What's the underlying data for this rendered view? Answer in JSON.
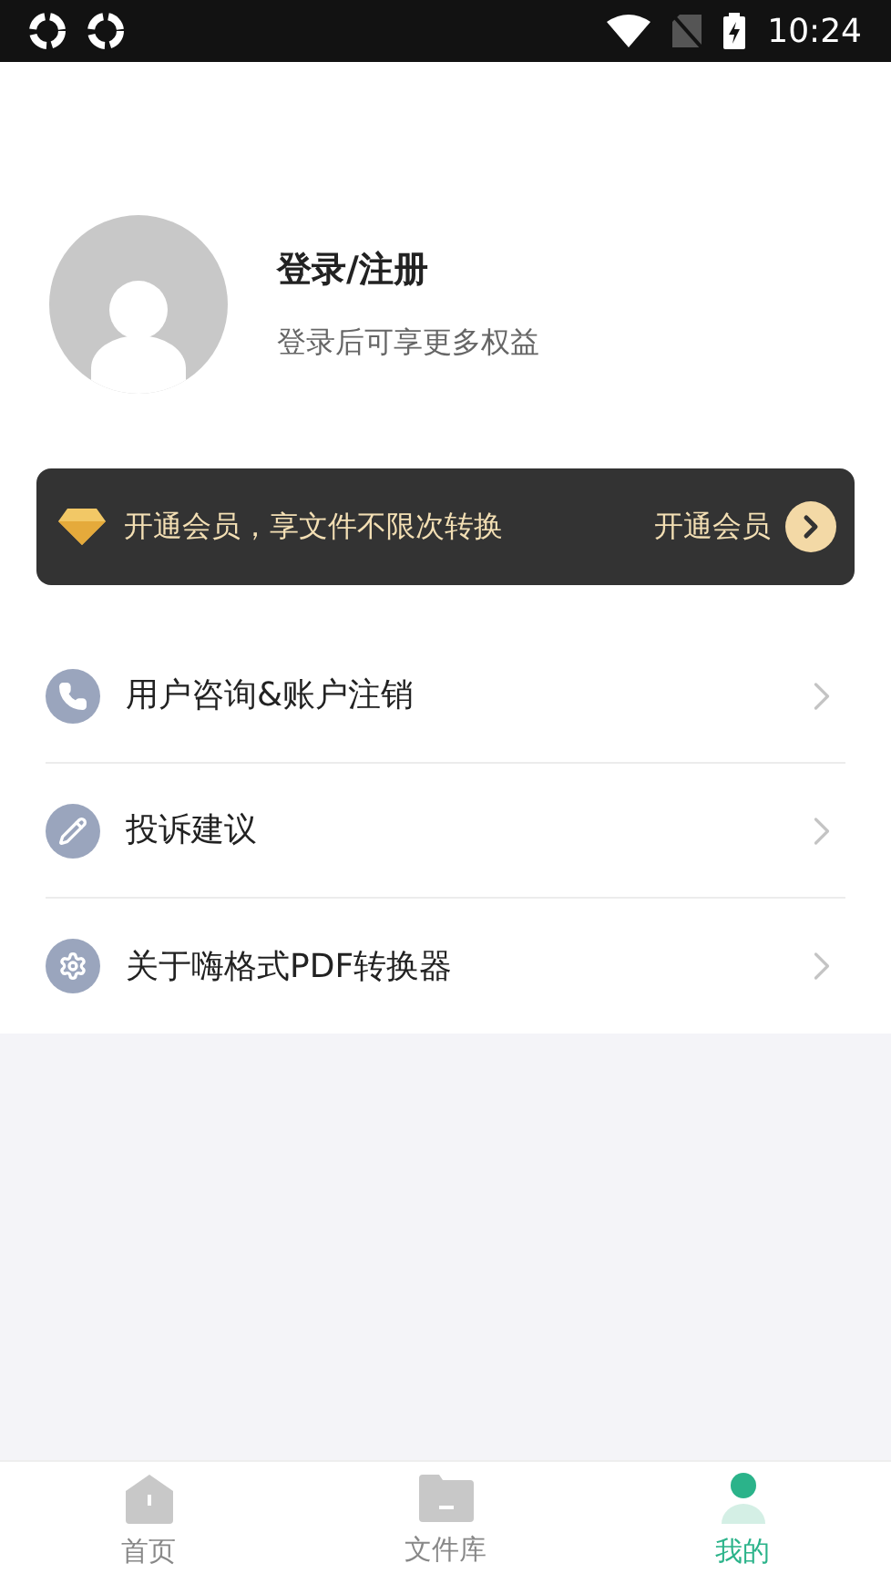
{
  "status_bar": {
    "time": "10:24"
  },
  "profile": {
    "title": "登录/注册",
    "subtitle": "登录后可享更多权益"
  },
  "vip_banner": {
    "text": "开通会员，享文件不限次转换",
    "action": "开通会员"
  },
  "menu": [
    {
      "kind": "phone",
      "label": "用户咨询&账户注销"
    },
    {
      "kind": "edit",
      "label": "投诉建议"
    },
    {
      "kind": "settings",
      "label": "关于嗨格式PDF转换器"
    }
  ],
  "tabs": [
    {
      "kind": "home",
      "label": "首页",
      "selected": false
    },
    {
      "kind": "folder",
      "label": "文件库",
      "selected": false
    },
    {
      "kind": "user",
      "label": "我的",
      "selected": true
    }
  ]
}
